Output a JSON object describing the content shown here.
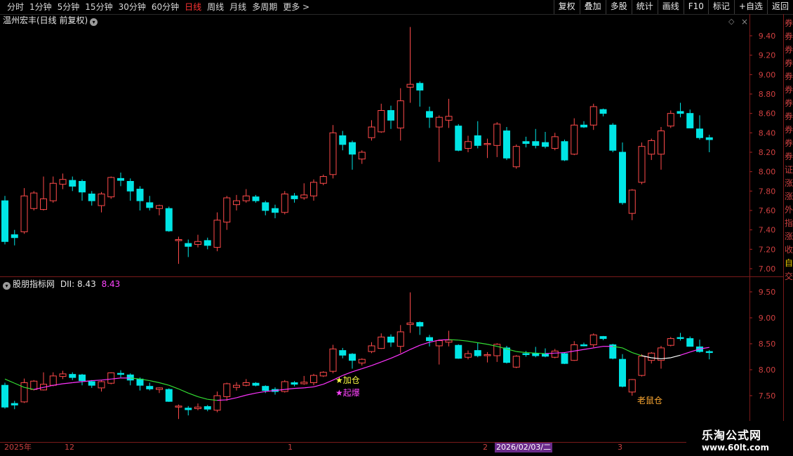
{
  "periods": [
    "分时",
    "1分钟",
    "5分钟",
    "15分钟",
    "30分钟",
    "60分钟",
    "日线",
    "周线",
    "月线",
    "多周期",
    "更多 >"
  ],
  "active_period": "日线",
  "toolbar": [
    "复权",
    "叠加",
    "多股",
    "统计",
    "画线",
    "F10",
    "标记",
    "+自选",
    "返回"
  ],
  "main_title": "温州宏丰(日线 前复权)",
  "indicator_title": "股朋指标网",
  "indicator_label": "DII: 8.43",
  "indicator_value": "8.43",
  "price_axis": [
    "9.40",
    "9.20",
    "9.00",
    "8.80",
    "8.60",
    "8.40",
    "8.20",
    "8.00",
    "7.80",
    "7.60",
    "7.40",
    "7.20",
    "7.00"
  ],
  "indicator_axis": [
    "9.50",
    "9.00",
    "8.50",
    "8.00",
    "7.50"
  ],
  "date_axis": {
    "year": "2025年",
    "m12": "12",
    "m1": "1",
    "m2": "2",
    "cursor": "2026/02/03/二",
    "m3": "3"
  },
  "signals": {
    "jiacang": "★加仓",
    "qibao": "★起爆",
    "laoshucang": "老鼠仓"
  },
  "right_strip_chars": [
    "券",
    "券",
    "券",
    "券",
    "券",
    "券",
    "券",
    "券",
    "券",
    "券",
    "券",
    "证",
    "涨",
    "涨",
    "外",
    "指",
    "涨",
    "收",
    "自",
    "交"
  ],
  "watermark": {
    "name": "乐淘公式网",
    "url": "www.60lt.com"
  },
  "colors": {
    "up": "#ff4a4a",
    "down": "#00e5e5",
    "bg": "#000000",
    "axis": "#8b0000",
    "ma_rise": "#ff33ff",
    "ma_fall": "#33dd33"
  },
  "chart_data": {
    "type": "candlestick",
    "title": "温州宏丰(日线 前复权)",
    "ylim": [
      7.0,
      9.4
    ],
    "candles": [
      {
        "o": 7.7,
        "h": 7.75,
        "l": 7.25,
        "c": 7.28
      },
      {
        "o": 7.35,
        "h": 7.4,
        "l": 7.24,
        "c": 7.32
      },
      {
        "o": 7.38,
        "h": 7.83,
        "l": 7.36,
        "c": 7.75
      },
      {
        "o": 7.62,
        "h": 7.8,
        "l": 7.6,
        "c": 7.78
      },
      {
        "o": 7.61,
        "h": 7.95,
        "l": 7.6,
        "c": 7.72
      },
      {
        "o": 7.7,
        "h": 7.95,
        "l": 7.68,
        "c": 7.88
      },
      {
        "o": 7.87,
        "h": 7.98,
        "l": 7.82,
        "c": 7.92
      },
      {
        "o": 7.91,
        "h": 7.95,
        "l": 7.8,
        "c": 7.85
      },
      {
        "o": 7.9,
        "h": 7.92,
        "l": 7.7,
        "c": 7.79
      },
      {
        "o": 7.77,
        "h": 7.8,
        "l": 7.65,
        "c": 7.7
      },
      {
        "o": 7.65,
        "h": 7.79,
        "l": 7.58,
        "c": 7.77
      },
      {
        "o": 7.74,
        "h": 7.95,
        "l": 7.72,
        "c": 7.94
      },
      {
        "o": 7.93,
        "h": 7.99,
        "l": 7.85,
        "c": 7.91
      },
      {
        "o": 7.9,
        "h": 7.93,
        "l": 7.7,
        "c": 7.8
      },
      {
        "o": 7.82,
        "h": 7.85,
        "l": 7.6,
        "c": 7.7
      },
      {
        "o": 7.68,
        "h": 7.75,
        "l": 7.6,
        "c": 7.63
      },
      {
        "o": 7.62,
        "h": 7.66,
        "l": 7.55,
        "c": 7.65
      },
      {
        "o": 7.62,
        "h": 7.64,
        "l": 7.38,
        "c": 7.39
      },
      {
        "o": 7.29,
        "h": 7.33,
        "l": 7.05,
        "c": 7.3
      },
      {
        "o": 7.26,
        "h": 7.3,
        "l": 7.12,
        "c": 7.23
      },
      {
        "o": 7.25,
        "h": 7.35,
        "l": 7.22,
        "c": 7.28
      },
      {
        "o": 7.29,
        "h": 7.32,
        "l": 7.2,
        "c": 7.24
      },
      {
        "o": 7.22,
        "h": 7.58,
        "l": 7.18,
        "c": 7.5
      },
      {
        "o": 7.48,
        "h": 7.75,
        "l": 7.4,
        "c": 7.73
      },
      {
        "o": 7.66,
        "h": 7.76,
        "l": 7.6,
        "c": 7.7
      },
      {
        "o": 7.7,
        "h": 7.82,
        "l": 7.68,
        "c": 7.75
      },
      {
        "o": 7.74,
        "h": 7.76,
        "l": 7.68,
        "c": 7.7
      },
      {
        "o": 7.68,
        "h": 7.7,
        "l": 7.55,
        "c": 7.6
      },
      {
        "o": 7.62,
        "h": 7.66,
        "l": 7.52,
        "c": 7.58
      },
      {
        "o": 7.58,
        "h": 7.8,
        "l": 7.56,
        "c": 7.77
      },
      {
        "o": 7.75,
        "h": 7.78,
        "l": 7.68,
        "c": 7.72
      },
      {
        "o": 7.73,
        "h": 7.88,
        "l": 7.71,
        "c": 7.76
      },
      {
        "o": 7.75,
        "h": 7.92,
        "l": 7.7,
        "c": 7.89
      },
      {
        "o": 7.88,
        "h": 7.97,
        "l": 7.86,
        "c": 7.95
      },
      {
        "o": 7.97,
        "h": 8.48,
        "l": 7.93,
        "c": 8.4
      },
      {
        "o": 8.37,
        "h": 8.42,
        "l": 8.22,
        "c": 8.28
      },
      {
        "o": 8.3,
        "h": 8.32,
        "l": 8.02,
        "c": 8.18
      },
      {
        "o": 8.13,
        "h": 8.22,
        "l": 8.08,
        "c": 8.2
      },
      {
        "o": 8.35,
        "h": 8.53,
        "l": 8.32,
        "c": 8.46
      },
      {
        "o": 8.41,
        "h": 8.7,
        "l": 8.4,
        "c": 8.63
      },
      {
        "o": 8.63,
        "h": 8.68,
        "l": 8.44,
        "c": 8.53
      },
      {
        "o": 8.45,
        "h": 8.86,
        "l": 8.32,
        "c": 8.73
      },
      {
        "o": 8.87,
        "h": 9.49,
        "l": 8.71,
        "c": 8.9
      },
      {
        "o": 8.91,
        "h": 8.93,
        "l": 8.67,
        "c": 8.84
      },
      {
        "o": 8.62,
        "h": 8.67,
        "l": 8.45,
        "c": 8.56
      },
      {
        "o": 8.46,
        "h": 8.58,
        "l": 8.1,
        "c": 8.56
      },
      {
        "o": 8.53,
        "h": 8.75,
        "l": 8.45,
        "c": 8.57
      },
      {
        "o": 8.47,
        "h": 8.49,
        "l": 8.21,
        "c": 8.22
      },
      {
        "o": 8.24,
        "h": 8.37,
        "l": 8.2,
        "c": 8.31
      },
      {
        "o": 8.37,
        "h": 8.52,
        "l": 8.24,
        "c": 8.27
      },
      {
        "o": 8.28,
        "h": 8.34,
        "l": 8.14,
        "c": 8.29
      },
      {
        "o": 8.27,
        "h": 8.51,
        "l": 8.15,
        "c": 8.49
      },
      {
        "o": 8.42,
        "h": 8.46,
        "l": 8.12,
        "c": 8.14
      },
      {
        "o": 8.05,
        "h": 8.28,
        "l": 8.03,
        "c": 8.26
      },
      {
        "o": 8.31,
        "h": 8.36,
        "l": 8.25,
        "c": 8.29
      },
      {
        "o": 8.31,
        "h": 8.44,
        "l": 8.24,
        "c": 8.27
      },
      {
        "o": 8.3,
        "h": 8.41,
        "l": 8.24,
        "c": 8.26
      },
      {
        "o": 8.24,
        "h": 8.4,
        "l": 8.22,
        "c": 8.36
      },
      {
        "o": 8.31,
        "h": 8.33,
        "l": 8.11,
        "c": 8.12
      },
      {
        "o": 8.18,
        "h": 8.55,
        "l": 8.17,
        "c": 8.48
      },
      {
        "o": 8.48,
        "h": 8.52,
        "l": 8.45,
        "c": 8.46
      },
      {
        "o": 8.48,
        "h": 8.7,
        "l": 8.43,
        "c": 8.67
      },
      {
        "o": 8.64,
        "h": 8.65,
        "l": 8.57,
        "c": 8.6
      },
      {
        "o": 8.48,
        "h": 8.5,
        "l": 8.2,
        "c": 8.22
      },
      {
        "o": 8.2,
        "h": 8.3,
        "l": 7.66,
        "c": 7.68
      },
      {
        "o": 7.57,
        "h": 7.82,
        "l": 7.5,
        "c": 7.81
      },
      {
        "o": 7.89,
        "h": 8.3,
        "l": 7.87,
        "c": 8.26
      },
      {
        "o": 8.18,
        "h": 8.34,
        "l": 8.12,
        "c": 8.32
      },
      {
        "o": 8.18,
        "h": 8.46,
        "l": 8.02,
        "c": 8.42
      },
      {
        "o": 8.47,
        "h": 8.63,
        "l": 8.45,
        "c": 8.6
      },
      {
        "o": 8.62,
        "h": 8.71,
        "l": 8.56,
        "c": 8.6
      },
      {
        "o": 8.6,
        "h": 8.64,
        "l": 8.45,
        "c": 8.45
      },
      {
        "o": 8.44,
        "h": 8.58,
        "l": 8.33,
        "c": 8.35
      },
      {
        "o": 8.35,
        "h": 8.38,
        "l": 8.2,
        "c": 8.33
      }
    ],
    "indicator": {
      "name": "股朋指标网",
      "ylim": [
        7.2,
        9.7
      ],
      "ma": [
        7.82,
        7.74,
        7.66,
        7.62,
        7.66,
        7.7,
        7.73,
        7.75,
        7.77,
        7.79,
        7.8,
        7.82,
        7.84,
        7.84,
        7.82,
        7.79,
        7.75,
        7.7,
        7.63,
        7.55,
        7.48,
        7.43,
        7.41,
        7.42,
        7.46,
        7.51,
        7.55,
        7.58,
        7.6,
        7.62,
        7.64,
        7.65,
        7.67,
        7.72,
        7.8,
        7.89,
        7.96,
        8.02,
        8.08,
        8.15,
        8.22,
        8.3,
        8.39,
        8.47,
        8.53,
        8.57,
        8.58,
        8.57,
        8.55,
        8.52,
        8.49,
        8.45,
        8.4,
        8.35,
        8.33,
        8.32,
        8.31,
        8.32,
        8.33,
        8.36,
        8.39,
        8.42,
        8.45,
        8.45,
        8.42,
        8.33,
        8.27,
        8.23,
        8.21,
        8.23,
        8.28,
        8.34,
        8.4,
        8.43
      ]
    }
  }
}
